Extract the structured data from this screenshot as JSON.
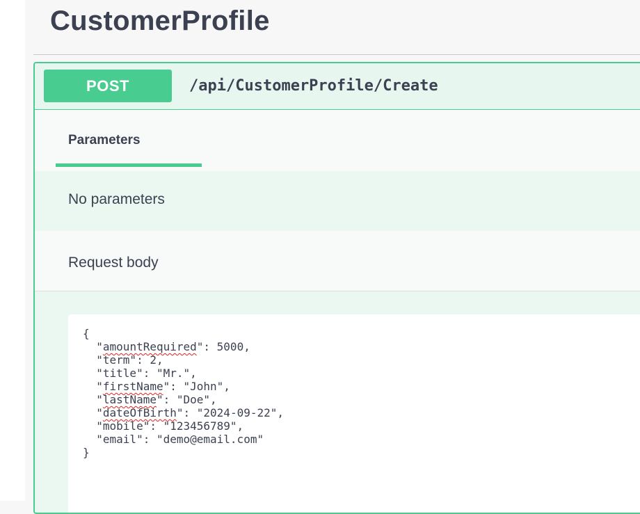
{
  "section": {
    "title": "CustomerProfile"
  },
  "operation": {
    "method": "POST",
    "path": "/api/CustomerProfile/Create"
  },
  "tabs": {
    "parameters_label": "Parameters"
  },
  "parameters": {
    "empty_text": "No parameters"
  },
  "request_body": {
    "label": "Request body",
    "json_lines": [
      {
        "pre": "{",
        "key": "",
        "post": ""
      },
      {
        "pre": "  \"",
        "key": "amountRequired",
        "post": "\": 5000,"
      },
      {
        "pre": "  \"term\": 2,",
        "key": "",
        "post": ""
      },
      {
        "pre": "  \"title\": \"Mr.\",",
        "key": "",
        "post": ""
      },
      {
        "pre": "  \"",
        "key": "firstName",
        "post": "\": \"John\","
      },
      {
        "pre": "  \"",
        "key": "lastName",
        "post": "\": \"Doe\","
      },
      {
        "pre": "  \"",
        "key": "dateOfBirth",
        "post": "\": \"2024-09-22\","
      },
      {
        "pre": "  \"mobile\": \"123456789\",",
        "key": "",
        "post": ""
      },
      {
        "pre": "  \"email\": \"demo@email.com\"",
        "key": "",
        "post": ""
      },
      {
        "pre": "}",
        "key": "",
        "post": ""
      }
    ]
  },
  "colors": {
    "post_green": "#49cc90",
    "text_dark": "#3b4151",
    "spellcheck_red": "#e02020"
  }
}
